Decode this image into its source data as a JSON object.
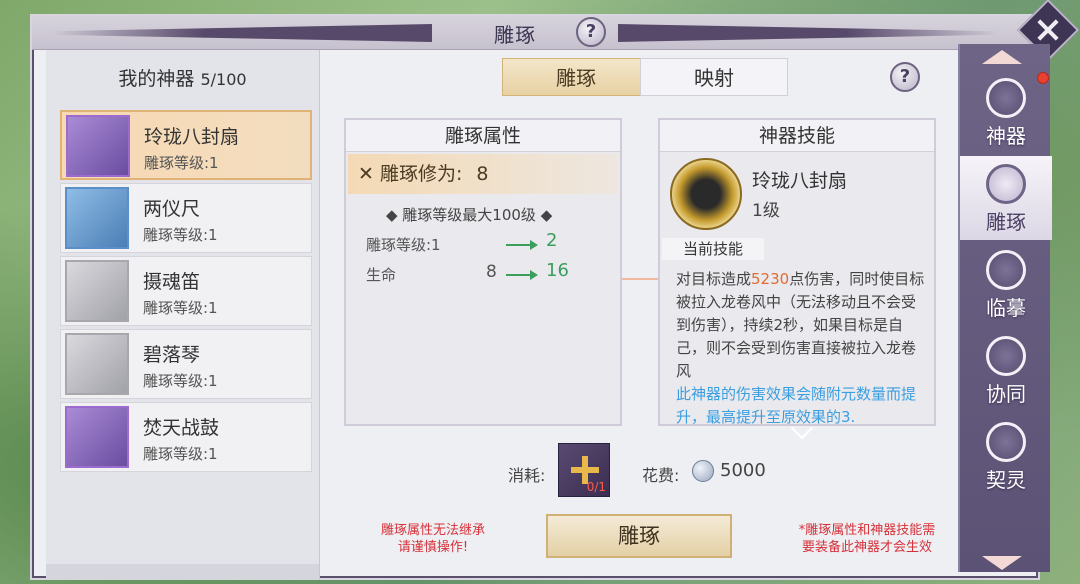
{
  "window": {
    "title": "雕琢"
  },
  "left_panel": {
    "title": "我的神器",
    "count": "5/100",
    "items": [
      {
        "name": "玲珑八封扇",
        "level": "雕琢等级:1",
        "icon": "fan-artifact-icon"
      },
      {
        "name": "两仪尺",
        "level": "雕琢等级:1",
        "icon": "ruler-artifact-icon"
      },
      {
        "name": "摄魂笛",
        "level": "雕琢等级:1",
        "icon": "flute-artifact-icon"
      },
      {
        "name": "碧落琴",
        "level": "雕琢等级:1",
        "icon": "zither-artifact-icon"
      },
      {
        "name": "焚天战鼓",
        "level": "雕琢等级:1",
        "icon": "drum-artifact-icon"
      }
    ]
  },
  "tabs": [
    {
      "label": "雕琢"
    },
    {
      "label": "映射"
    }
  ],
  "attr_panel": {
    "title": "雕琢属性",
    "cultivation_label": "雕琢修为:",
    "cultivation_value": "8",
    "max_level": "◆ 雕琢等级最大100级 ◆",
    "rows": [
      {
        "label": "雕琢等级:1",
        "from": "",
        "to": "2"
      },
      {
        "label": "生命",
        "from": "8",
        "to": "16"
      }
    ]
  },
  "skill_panel": {
    "title": "神器技能",
    "name": "玲珑八封扇",
    "level": "1级",
    "current_label": "当前技能",
    "desc_pre": "对目标造成",
    "desc_damage": "5230",
    "desc_post": "点伤害，同时使目标被拉入龙卷风中（无法移动且不会受到伤害），持续2秒，如果目标是自己，则不会受到伤害直接被拉入龙卷风",
    "desc_blue": "此神器的伤害效果会随附元数量而提升，最高提升至原效果的3."
  },
  "cost": {
    "consume_label": "消耗:",
    "item_qty": "0/1",
    "fee_label": "花费:",
    "fee_value": "5000"
  },
  "warnings": {
    "left": "雕琢属性无法继承\n请谨慎操作!",
    "right": "*雕琢属性和神器技能需\n要装备此神器才会生效"
  },
  "action_button": "雕琢",
  "right_nav": [
    {
      "label": "神器",
      "icon": "artifact-icon"
    },
    {
      "label": "雕琢",
      "icon": "carve-icon"
    },
    {
      "label": "临摹",
      "icon": "copy-icon"
    },
    {
      "label": "协同",
      "icon": "crossed-swords-icon"
    },
    {
      "label": "契灵",
      "icon": "spirit-icon"
    }
  ],
  "colors": {
    "accent": "#e0b276",
    "nav_bg": "#5c5275",
    "green": "#3b9e5d",
    "damage": "#e36b2e",
    "info_blue": "#3b9ee0",
    "warning": "#d6313a"
  }
}
